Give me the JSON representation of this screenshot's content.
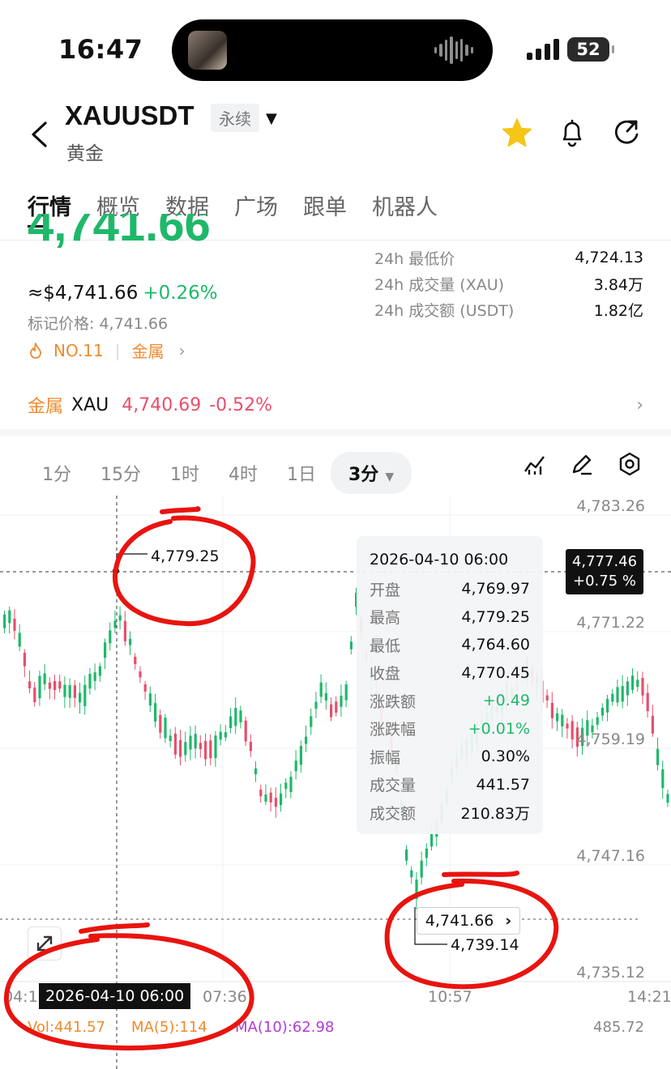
{
  "status_bar": {
    "time": "16:47",
    "battery": "52"
  },
  "header": {
    "symbol": "XAUUSDT",
    "contract_type": "永续",
    "subtitle": "黄金"
  },
  "tabs": [
    "行情",
    "概览",
    "数据",
    "广场",
    "跟单",
    "机器人"
  ],
  "price": {
    "last": "4,741.66",
    "approx": "≈$4,741.66",
    "change_pct": "+0.26%",
    "mark_price": "标记价格: 4,741.66",
    "rank": "NO.11",
    "category": "金属"
  },
  "stats": [
    {
      "label": "24h 最低价",
      "value": "4,724.13"
    },
    {
      "label": "24h 成交量 (XAU)",
      "value": "3.84万"
    },
    {
      "label": "24h 成交额 (USDT)",
      "value": "1.82亿"
    }
  ],
  "metal_row": {
    "tag": "金属",
    "symbol": "XAU",
    "price": "4,740.69",
    "change": "-0.52%"
  },
  "intervals": [
    "1分",
    "15分",
    "1时",
    "4时",
    "1日"
  ],
  "active_interval": "3分",
  "chart": {
    "y_labels": [
      "4,783.26",
      "4,771.22",
      "4,759.19",
      "4,747.16",
      "4,735.12"
    ],
    "x_labels": [
      "04:15",
      "07:36",
      "10:57",
      "14:21"
    ],
    "price_tag": {
      "price": "4,777.46",
      "pct": "+0.75 %"
    },
    "current_price": "4,741.66",
    "high_label": "4,779.25",
    "low_label": "4,739.14",
    "cursor_time": "2026-04-10 06:00",
    "volume": {
      "vol": "Vol:441.57",
      "ma5": "MA(5):114",
      "ma10": "MA(10):62.98",
      "max": "485.72"
    },
    "colors": {
      "up": "#1fb86a",
      "down": "#e84f6b",
      "annotation": "#e8140f"
    }
  },
  "tooltip": {
    "date": "2026-04-10 06:00",
    "rows": [
      {
        "label": "开盘",
        "value": "4,769.97"
      },
      {
        "label": "最高",
        "value": "4,779.25"
      },
      {
        "label": "最低",
        "value": "4,764.60"
      },
      {
        "label": "收盘",
        "value": "4,770.45"
      },
      {
        "label": "涨跌额",
        "value": "+0.49"
      },
      {
        "label": "涨跌幅",
        "value": "+0.01%"
      },
      {
        "label": "振幅",
        "value": "0.30%"
      },
      {
        "label": "成交量",
        "value": "441.57"
      },
      {
        "label": "成交额",
        "value": "210.83万"
      }
    ]
  }
}
